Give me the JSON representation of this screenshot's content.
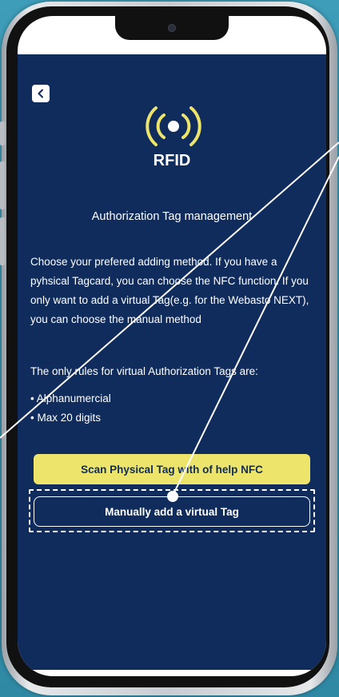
{
  "header": {
    "back_icon": "chevron-left-icon"
  },
  "hero": {
    "icon": "rfid-signal-icon",
    "label": "RFID"
  },
  "content": {
    "heading": "Authorization Tag management",
    "paragraph": "Choose your prefered adding method. If you have a pyhsical Tagcard, you can choose the NFC function. If you only want to add a virtual Tag(e.g. for the Webasto NEXT), you can choose the manual method",
    "rules_intro": "The only rules for virtual Authorization Tags are:",
    "rules": [
      "• Alphanumercial",
      "• Max 20 digits"
    ]
  },
  "actions": {
    "scan_label": "Scan Physical Tag with of help NFC",
    "manual_label": "Manually add a virtual Tag"
  },
  "colors": {
    "app_background": "#0f2c5c",
    "accent_yellow": "#ede56b",
    "text": "#ffffff"
  }
}
